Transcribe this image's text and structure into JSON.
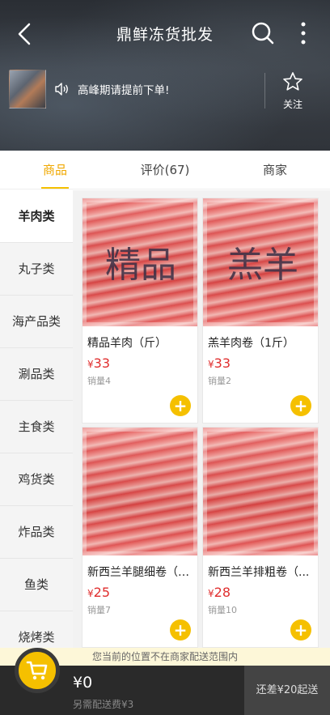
{
  "header": {
    "title": "鼎鲜冻货批发",
    "notice": "高峰期请提前下单!",
    "follow_label": "关注"
  },
  "tabs": [
    {
      "label": "商品",
      "active": true
    },
    {
      "label": "评价(67)",
      "active": false
    },
    {
      "label": "商家",
      "active": false
    }
  ],
  "categories": [
    "羊肉类",
    "丸子类",
    "海产品类",
    "涮品类",
    "主食类",
    "鸡货类",
    "炸品类",
    "鱼类",
    "烧烤类"
  ],
  "products": [
    {
      "name": "精品羊肉（斤）",
      "currency": "¥",
      "price": "33",
      "sales": "销量4",
      "photo_text": "精品"
    },
    {
      "name": "羔羊肉卷（1斤）",
      "currency": "¥",
      "price": "33",
      "sales": "销量2",
      "photo_text": "羔羊"
    },
    {
      "name": "新西兰羊腿细卷（1...",
      "currency": "¥",
      "price": "25",
      "sales": "销量7",
      "photo_text": ""
    },
    {
      "name": "新西兰羊排粗卷（...",
      "currency": "¥",
      "price": "28",
      "sales": "销量10",
      "photo_text": ""
    }
  ],
  "banner": "您当前的位置不在商家配送范围内",
  "cart": {
    "total": "¥0",
    "delivery_fee": "另需配送费¥3",
    "checkout": "还差¥20起送"
  },
  "colors": {
    "accent": "#f5c000",
    "price": "#e02e2e"
  }
}
